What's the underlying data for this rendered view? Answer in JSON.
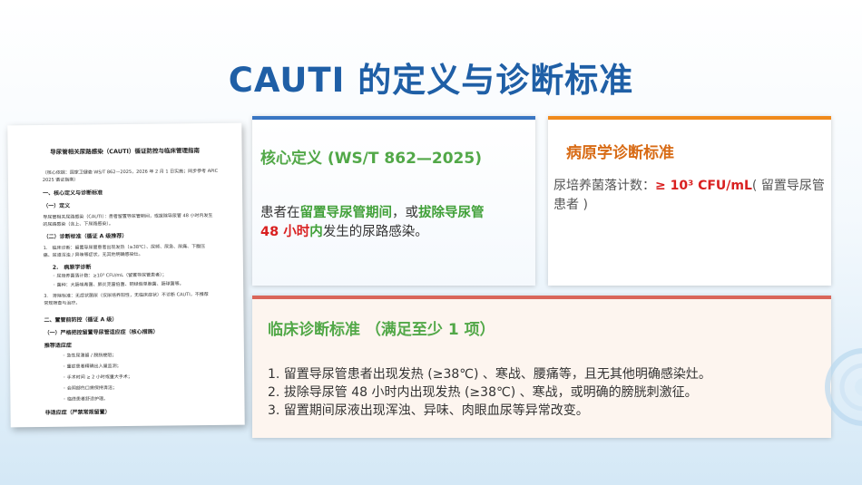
{
  "title": "CAUTI 的定义与诊断标准",
  "document": {
    "title": "导尿管相关尿路感染（CAUTI）循证防控与临床管理指南",
    "lines": [
      "（核心依据：国家卫健委 WS/T 862—2025，2026 年 2 月 1 日实施；同步参考 APIC",
      "2025 循证指南）",
      "一、核心定义与诊断标准",
      "（一）定义",
      "导尿管相关尿路感染（CAUTI）：患者留置导尿管期间，或拔除导尿管 48 小时内发生",
      "的尿路感染（含上、下尿路感染）。",
      "（二）诊断标准（循证 A 级推荐）",
      "1.　临床诊断：留置导尿管患者出现发热（≥38℃）、尿频、尿急、尿痛、下腹压",
      "痛、尿道浑浊 / 异味等症状，无其他明确感染灶。",
      "2.　病原学诊断",
      "◦ 尿培养菌落计数：≥10³ CFU/mL（留置导尿管患者）；",
      "◦ 菌种：大肠埃希菌、肺炎克雷伯菌、铜绿假单胞菌、肠球菌等。",
      "3.　排除标准：无症状菌尿（仅尿培养阳性，无临床症状）不诊断 CAUTI，不推荐",
      "常规筛查与治疗。",
      "二、置管前防控（循证 A 级）",
      "（一）严格把控留置导尿管适应症（核心措施）",
      "推荐适应症",
      "◦ 急性尿潴留 / 膀胱梗阻；",
      "◦ 重症患者精确出入量监测；",
      "◦ 手术时间 ≥ 2 小时或重大手术；",
      "◦ 会阴部伤口需保持清洁；",
      "◦ 临终患者舒适护理。",
      "非适应症（严禁常规留置）"
    ]
  },
  "card_core": {
    "heading": "核心定义 (WS/T 862—2025)",
    "t1": "患者在",
    "t2": "留置导尿管期间",
    "t3": "，或",
    "t4": "拔除导尿管",
    "t5": "48 小时",
    "t6": "内",
    "t7": "发生的尿路感染。"
  },
  "card_pathogen": {
    "heading": "病原学诊断标准",
    "t1": "尿培养菌落计数：",
    "t2": "≥ 10³ CFU/mL",
    "t3": "( 留置导尿管患者 )"
  },
  "card_clinical": {
    "heading": "临床诊断标准 （满足至少 1 项）",
    "items": [
      "1.  留置导尿管患者出现发热 (≥38℃) 、寒战、腰痛等，且无其他明确感染灶。",
      "2.  拔除导尿管 48 小时内出现发热 (≥38℃) 、寒战，或明确的膀胱刺激征。",
      "3.  留置期间尿液出现浑浊、异味、肉眼血尿等异常改变。"
    ]
  },
  "colors": {
    "title": "#1f5fa6",
    "core_border": "#3a76c2",
    "pathogen_border": "#f08a1c",
    "clinical_border": "#d9665a",
    "green_text": "#42a13a",
    "red_text": "#d92020"
  }
}
